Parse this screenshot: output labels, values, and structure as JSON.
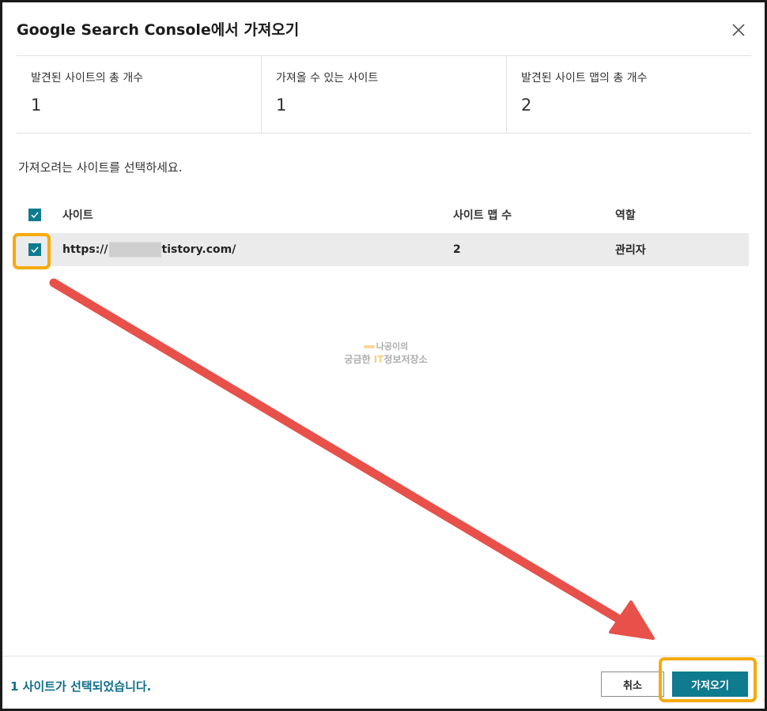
{
  "dialog": {
    "title": "Google Search Console에서 가져오기",
    "instruction": "가져오려는 사이트를 선택하세요."
  },
  "stats": [
    {
      "label": "발견된 사이트의 총 개수",
      "value": "1"
    },
    {
      "label": "가져올 수 있는 사이트",
      "value": "1"
    },
    {
      "label": "발견된 사이트 맵의 총 개수",
      "value": "2"
    }
  ],
  "table": {
    "headers": {
      "site": "사이트",
      "sitemaps": "사이트 맵 수",
      "role": "역할"
    },
    "rows": [
      {
        "url_prefix": "https://",
        "url_suffix": "tistory.com/",
        "sitemaps": "2",
        "role": "관리자",
        "checked": true
      }
    ]
  },
  "watermark": {
    "line1": "나공이의",
    "line2_a": "궁금한 ",
    "line2_it": "IT",
    "line2_b": "정보저장소"
  },
  "footer": {
    "status": "1 사이트가 선택되었습니다.",
    "cancel_label": "취소",
    "import_label": "가져오기"
  },
  "colors": {
    "accent": "#0f7b8f",
    "highlight": "#f5ab0a",
    "arrow": "#e8504a"
  }
}
